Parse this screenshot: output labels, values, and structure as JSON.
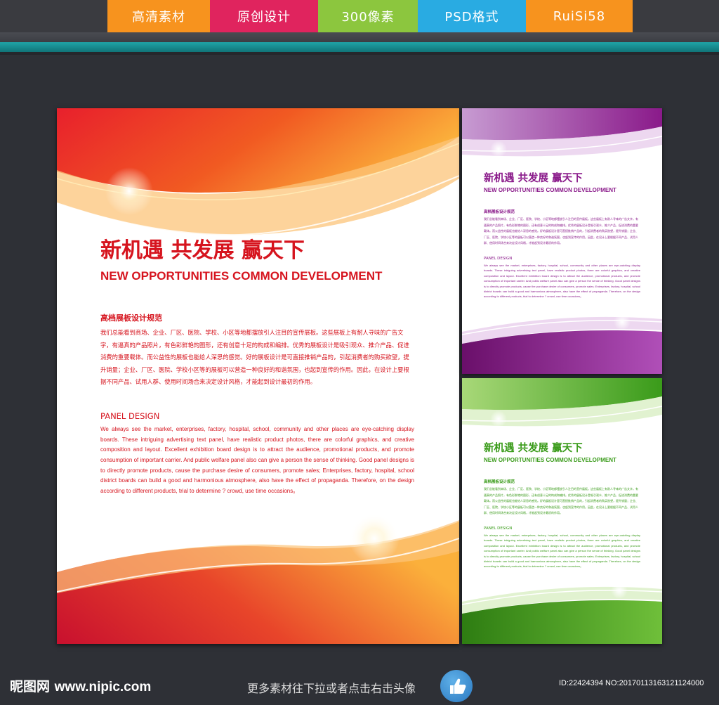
{
  "header": {
    "tabs": [
      {
        "label": "高清素材",
        "color": "#f7931e"
      },
      {
        "label": "原创设计",
        "color": "#e0245e"
      },
      {
        "label": "300像素",
        "color": "#8cc63e"
      },
      {
        "label": "PSD格式",
        "color": "#29abe2"
      },
      {
        "label": "RuiSi58",
        "color": "#f7931e"
      }
    ]
  },
  "colors": {
    "red_board": "#e0162b",
    "purple_board": "#8a1a8a",
    "green_board": "#3a9b1a",
    "background": "#2e3036",
    "accent_teal": "#1fa3a6"
  },
  "board": {
    "cn_title": "新机遇 共发展 赢天下",
    "en_title": "NEW OPPORTUNITIES COMMON DEVELOPMENT",
    "subhead_cn": "高档展板设计规范",
    "body_cn": "我们总能看到商场、企业、厂区、医院、学校、小区等地都摆放引人注目的宣传展板。这些展板上有耐人寻味的广告文字，有逼真的产品照片，有色彩鲜艳的图形，还有创意十足的构成和编排。优秀的展板设计是吸引观众、推介产品、促进消费的重要载体。而公益性的展板也能给人深思的感觉。好的展板设计是可直接推销产品的，引起消费者的购买欲望，提升销量；企业、厂区、医院、学校小区等的展板可以营造一种良好的和谐氛围，也起到宣传的作用。因此，在设计上要根据不同产品、试用人群、使用时间场合来决定设计风格，才能起到设计最初的作用。",
    "subhead_en": "PANEL DESIGN",
    "body_en": "We always see the market, enterprises, factory, hospital, school, community and other places are eye-catching display boards. These intriguing advertising text panel, have realistic product photos, there are colorful graphics, and creative composition and layout. Excellent exhibition board design is to attract the audience, promotional products, and promote consumption of important carrier. And public welfare panel also can give a person the sense of thinking. Good panel designs is to directly promote products, cause the purchase desire of consumers, promote sales; Enterprises, factory, hospital, school district boards can build a good and harmonious atmosphere, also have the effect of propaganda. Therefore, on the design according to different products, trial to determine ? crowd, use time occasions。"
  },
  "footer": {
    "site_cn": "昵图网",
    "site_url": "www.nipic.com",
    "more_text": "更多素材往下拉或者点击右击头像",
    "thumb_icon": "thumbs-up-icon",
    "image_id": "ID:22424394 NO:20170113163121124000"
  }
}
